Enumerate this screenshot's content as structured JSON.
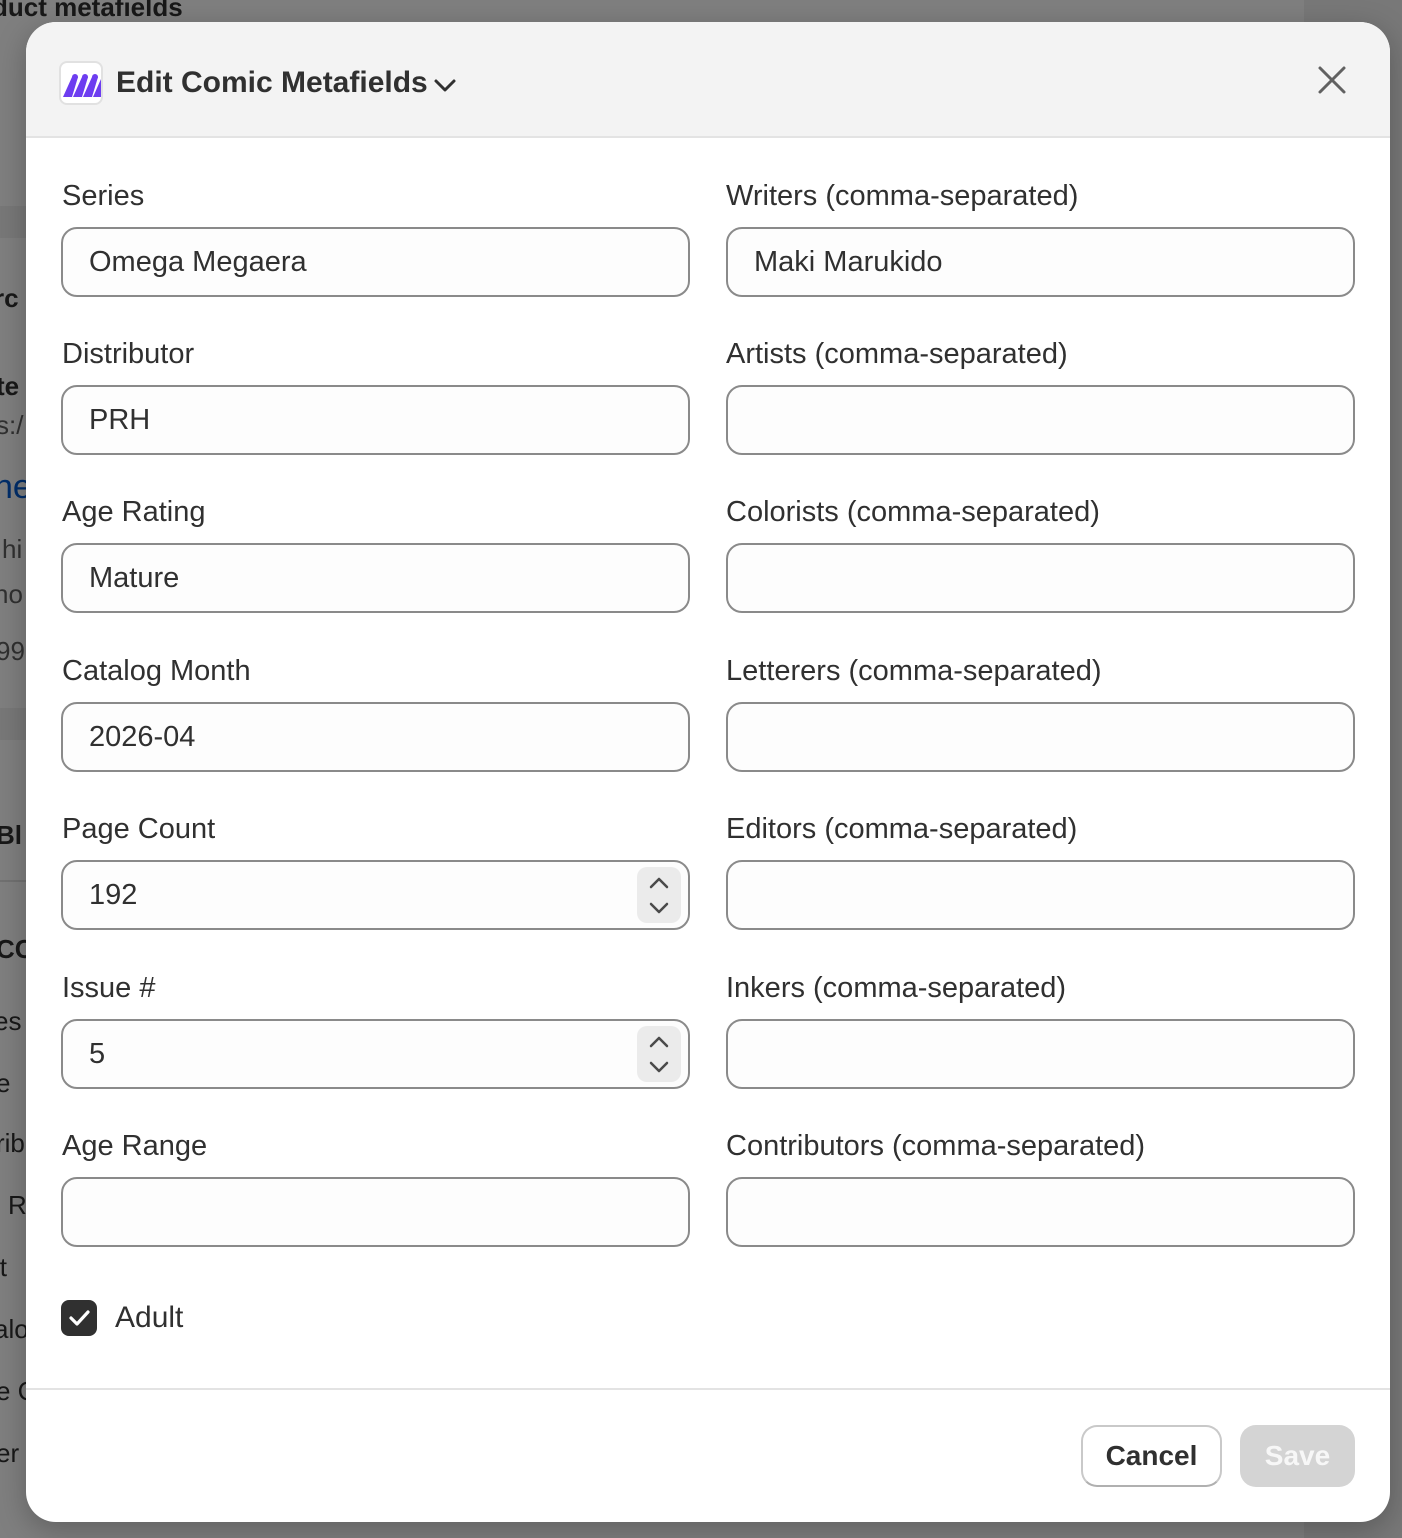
{
  "background": {
    "fragments": [
      "duct metafields",
      "rc",
      "te",
      "s:/",
      "ne",
      "hi",
      "no",
      "99",
      "Bl",
      "CC",
      "es",
      "e",
      "rib",
      "R",
      "lt",
      "alo",
      "e C",
      "er"
    ]
  },
  "modal": {
    "title": "Edit Comic Metafields",
    "app_icon": "app-logo-icon",
    "colors": {
      "accent": "#6d3df0",
      "primary_button": "#303030",
      "disabled_button": "#d4d4d4"
    },
    "left_fields": [
      {
        "label": "Series",
        "value": "Omega Megaera",
        "type": "text"
      },
      {
        "label": "Distributor",
        "value": "PRH",
        "type": "text"
      },
      {
        "label": "Age Rating",
        "value": "Mature",
        "type": "text"
      },
      {
        "label": "Catalog Month",
        "value": "2026-04",
        "type": "text"
      },
      {
        "label": "Page Count",
        "value": "192",
        "type": "number"
      },
      {
        "label": "Issue #",
        "value": "5",
        "type": "number"
      },
      {
        "label": "Age Range",
        "value": "",
        "type": "text"
      }
    ],
    "right_fields": [
      {
        "label": "Writers (comma-separated)",
        "value": "Maki Marukido"
      },
      {
        "label": "Artists (comma-separated)",
        "value": ""
      },
      {
        "label": "Colorists (comma-separated)",
        "value": ""
      },
      {
        "label": "Letterers (comma-separated)",
        "value": ""
      },
      {
        "label": "Editors (comma-separated)",
        "value": ""
      },
      {
        "label": "Inkers (comma-separated)",
        "value": ""
      },
      {
        "label": "Contributors (comma-separated)",
        "value": ""
      }
    ],
    "adult": {
      "label": "Adult",
      "checked": true
    },
    "footer": {
      "cancel_label": "Cancel",
      "save_label": "Save",
      "save_disabled": true
    }
  }
}
